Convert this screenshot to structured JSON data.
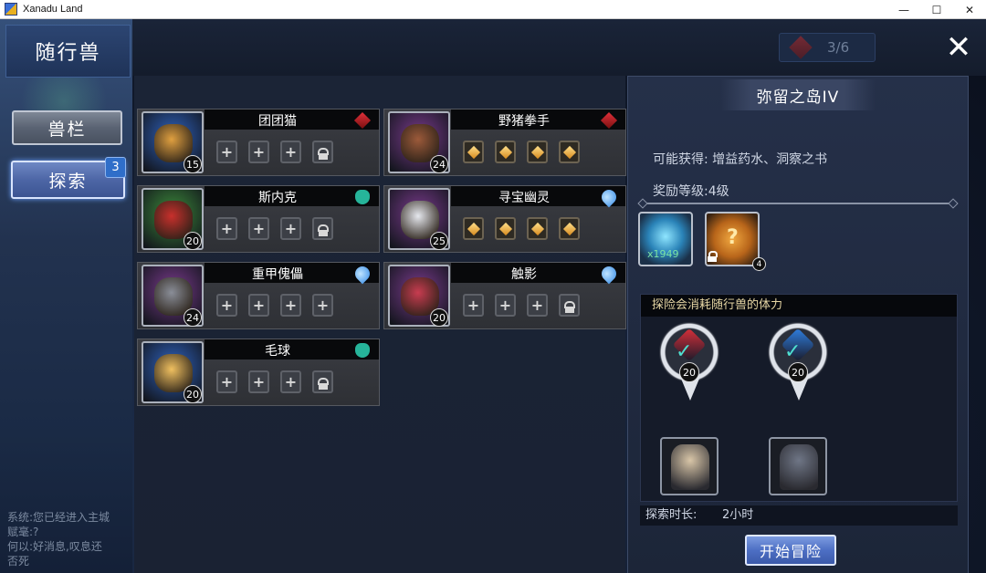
{
  "window": {
    "title": "Xanadu Land",
    "minimize": "—",
    "maximize": "☐",
    "close": "✕"
  },
  "header": {
    "title": "随行兽",
    "stamina": "3/6",
    "close_glyph": "✕"
  },
  "sidebar": {
    "pets_label": "兽栏",
    "explore_label": "探索",
    "explore_badge": "3"
  },
  "system_chat": {
    "lines": [
      "系统:您已经进入主城",
      "赋毫:?",
      "何以:好消息,叹息还",
      "否死"
    ]
  },
  "pets": [
    {
      "name": "团团猫",
      "level": "15",
      "element": "fire",
      "element_color": "#e0303a",
      "portrait_color": "#2f63c0",
      "creature_color": "#e0a040",
      "slots": [
        "plus",
        "plus",
        "plus",
        "lock"
      ]
    },
    {
      "name": "野猪拳手",
      "level": "24",
      "element": "fire",
      "element_color": "#e0303a",
      "portrait_color": "#7a3a8c",
      "creature_color": "#9c5a3a",
      "slots": [
        "gem",
        "gem",
        "gem",
        "gem"
      ]
    },
    {
      "name": "斯内克",
      "level": "20",
      "element": "wind",
      "element_color": "#26b49a",
      "portrait_color": "#3c8a3a",
      "creature_color": "#c8302c",
      "slots": [
        "plus",
        "plus",
        "plus",
        "lock"
      ]
    },
    {
      "name": "寻宝幽灵",
      "level": "25",
      "element": "water",
      "element_color": "#3a8ee8",
      "portrait_color": "#7a3a8c",
      "creature_color": "#e6e8ee",
      "slots": [
        "gem",
        "gem",
        "gem",
        "gem"
      ]
    },
    {
      "name": "重甲傀儡",
      "level": "24",
      "element": "water",
      "element_color": "#3a8ee8",
      "portrait_color": "#7a3a8c",
      "creature_color": "#8a8e98",
      "slots": [
        "plus",
        "plus",
        "plus",
        "plus"
      ]
    },
    {
      "name": "触影",
      "level": "20",
      "element": "water",
      "element_color": "#3a8ee8",
      "portrait_color": "#7a3a8c",
      "creature_color": "#c83c50",
      "slots": [
        "plus",
        "plus",
        "plus",
        "lock"
      ]
    },
    {
      "name": "毛球",
      "level": "20",
      "element": "wind",
      "element_color": "#26b49a",
      "portrait_color": "#2f63c0",
      "creature_color": "#f0c060",
      "slots": [
        "plus",
        "plus",
        "plus",
        "lock"
      ]
    }
  ],
  "detail": {
    "island_title": "弥留之岛IV",
    "rewards_text": "可能获得: 增益药水、洞察之书",
    "reward_level": "奖励等级:4级",
    "items": [
      {
        "icon": "potion-icon",
        "count": "x1949"
      },
      {
        "icon": "mystery-book-icon",
        "level": "4",
        "locked": true
      }
    ],
    "explore_note": "探险会消耗随行兽的体力",
    "requirements": [
      {
        "stat": "fire",
        "gem_color": "#d8303a",
        "value": "20"
      },
      {
        "stat": "water",
        "gem_color": "#2f7fe0",
        "value": "20"
      }
    ],
    "assigned_pets": [
      {
        "icon": "armored-knight-pet-icon",
        "color": "#d9c6a8"
      },
      {
        "icon": "gray-wolf-pet-icon",
        "color": "#6f7686"
      }
    ],
    "duration_label": "探索时长:",
    "duration_value": "2小时",
    "start_button": "开始冒险"
  }
}
